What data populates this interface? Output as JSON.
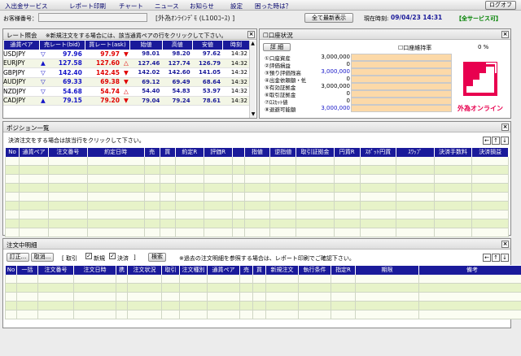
{
  "menu": {
    "items": [
      "入出金サービス",
      "レポート印刷",
      "チャート",
      "ニュース",
      "お知らせ",
      "設定",
      "困った時は？"
    ],
    "logoff": "ログオフ"
  },
  "account": {
    "label": "お客様番号：",
    "course": "[外為ｵﾝﾗｲﾝﾃﾞﾓ (L100ｺｰｽ) ]",
    "refresh_all": "全て最新表示",
    "time_label": "現在時刻:",
    "time": "09/04/23 14:31",
    "service": "【全サービス可】"
  },
  "rates": {
    "title": "レート照会",
    "note": "※新規注文をする場合には、該当通貨ペアの行をクリックして下さい。",
    "headers": [
      "通貨ペア",
      "売レート(bid)",
      "買レート(ask)",
      "始値",
      "高値",
      "安値",
      "時刻"
    ],
    "rows": [
      {
        "pair": "USDJPY",
        "sell_dir": "down",
        "bid": "97.96",
        "ask": "97.97",
        "buy_dir": "down",
        "open": "98.01",
        "high": "98.20",
        "low": "97.62",
        "time": "14:32"
      },
      {
        "pair": "EURJPY",
        "sell_dir": "up",
        "bid": "127.58",
        "ask": "127.60",
        "buy_dir": "up",
        "open": "127.46",
        "high": "127.74",
        "low": "126.79",
        "time": "14:32"
      },
      {
        "pair": "GBPJPY",
        "sell_dir": "down",
        "bid": "142.40",
        "ask": "142.45",
        "buy_dir": "down",
        "open": "142.02",
        "high": "142.60",
        "low": "141.05",
        "time": "14:32"
      },
      {
        "pair": "AUDJPY",
        "sell_dir": "down",
        "bid": "69.33",
        "ask": "69.38",
        "buy_dir": "down",
        "open": "69.12",
        "high": "69.49",
        "low": "68.64",
        "time": "14:32"
      },
      {
        "pair": "NZDJPY",
        "sell_dir": "down",
        "bid": "54.68",
        "ask": "54.74",
        "buy_dir": "up",
        "open": "54.40",
        "high": "54.83",
        "low": "53.97",
        "time": "14:32"
      },
      {
        "pair": "CADJPY",
        "sell_dir": "up",
        "bid": "79.15",
        "ask": "79.20",
        "buy_dir": "down",
        "open": "79.04",
        "high": "79.24",
        "low": "78.61",
        "time": "14:32"
      }
    ]
  },
  "account_status": {
    "title": "口座状況",
    "detail": "詳 細",
    "ratio_label": "口座維持率",
    "ratio_value": "0 %",
    "rows": [
      {
        "label": "①口座資産",
        "value": "3,000,000"
      },
      {
        "label": "②評価損益",
        "value": "0"
      },
      {
        "label": "③預り評価残高",
        "value": "3,000,000"
      },
      {
        "label": "④出金依頼額・他",
        "value": "0"
      },
      {
        "label": "⑤有効証拠金",
        "value": "3,000,000"
      },
      {
        "label": "⑥取引証拠金",
        "value": "0"
      },
      {
        "label": "⑦ﾛｽｶｯﾄ値",
        "value": "0"
      },
      {
        "label": "⑧退避可能額",
        "value": "3,000,000"
      }
    ],
    "logo_text": "外為オンライン"
  },
  "positions": {
    "title": "ポジション一覧",
    "note": "決済注文をする場合は該当行をクリックして下さい。",
    "headers": [
      "No",
      "通貨ペア",
      "注文番号",
      "約定日時",
      "売",
      "買",
      "約定R",
      "評価R",
      "",
      "指値",
      "逆指値",
      "取引証拠金",
      "円貨R",
      "ｽﾎﾟｯﾄ円貨",
      "ｽﾜｯﾌﾟ",
      "決済手数料",
      "決済損益"
    ]
  },
  "orders": {
    "title": "注文中明細",
    "cancel_btn": "訂正...",
    "delete_btn": "取消...",
    "filter_label": "[ 取引",
    "new_label": "新規",
    "settle_label": "決済",
    "filter_end": "]",
    "search_btn": "検索",
    "note": "※過去の注文明細を参照する場合は、レポート印刷でご確認下さい。",
    "headers": [
      "No",
      "一括",
      "注文番号",
      "注文日時",
      "携",
      "注文状況",
      "取引",
      "注文種別",
      "通貨ペア",
      "売",
      "買",
      "新規注文",
      "執行条件",
      "指定R",
      "期限",
      "備考"
    ]
  },
  "colors": {
    "header_blue": "#1a1a9a",
    "bid_blue": "#1515c8",
    "ask_red": "#e00000",
    "row_green": "#e7f3c9",
    "bar_orange": "#fcd9a8",
    "logo_red": "#e8004f"
  }
}
